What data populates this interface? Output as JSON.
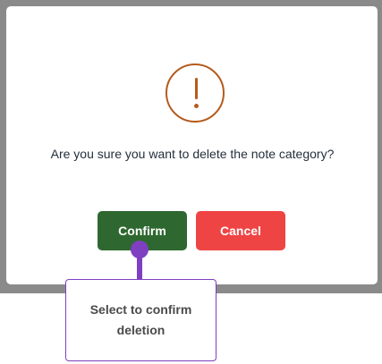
{
  "dialog": {
    "icon": "exclamation-circle-icon",
    "message": "Are you sure you want to delete the note category?",
    "confirm_label": "Confirm",
    "cancel_label": "Cancel"
  },
  "tooltip": {
    "text": "Select to confirm deletion"
  },
  "colors": {
    "warning": "#b65b1d",
    "confirm": "#2e6830",
    "cancel": "#ef4444",
    "annotation": "#7f3fc1",
    "overlay": "#8a8a8a"
  }
}
